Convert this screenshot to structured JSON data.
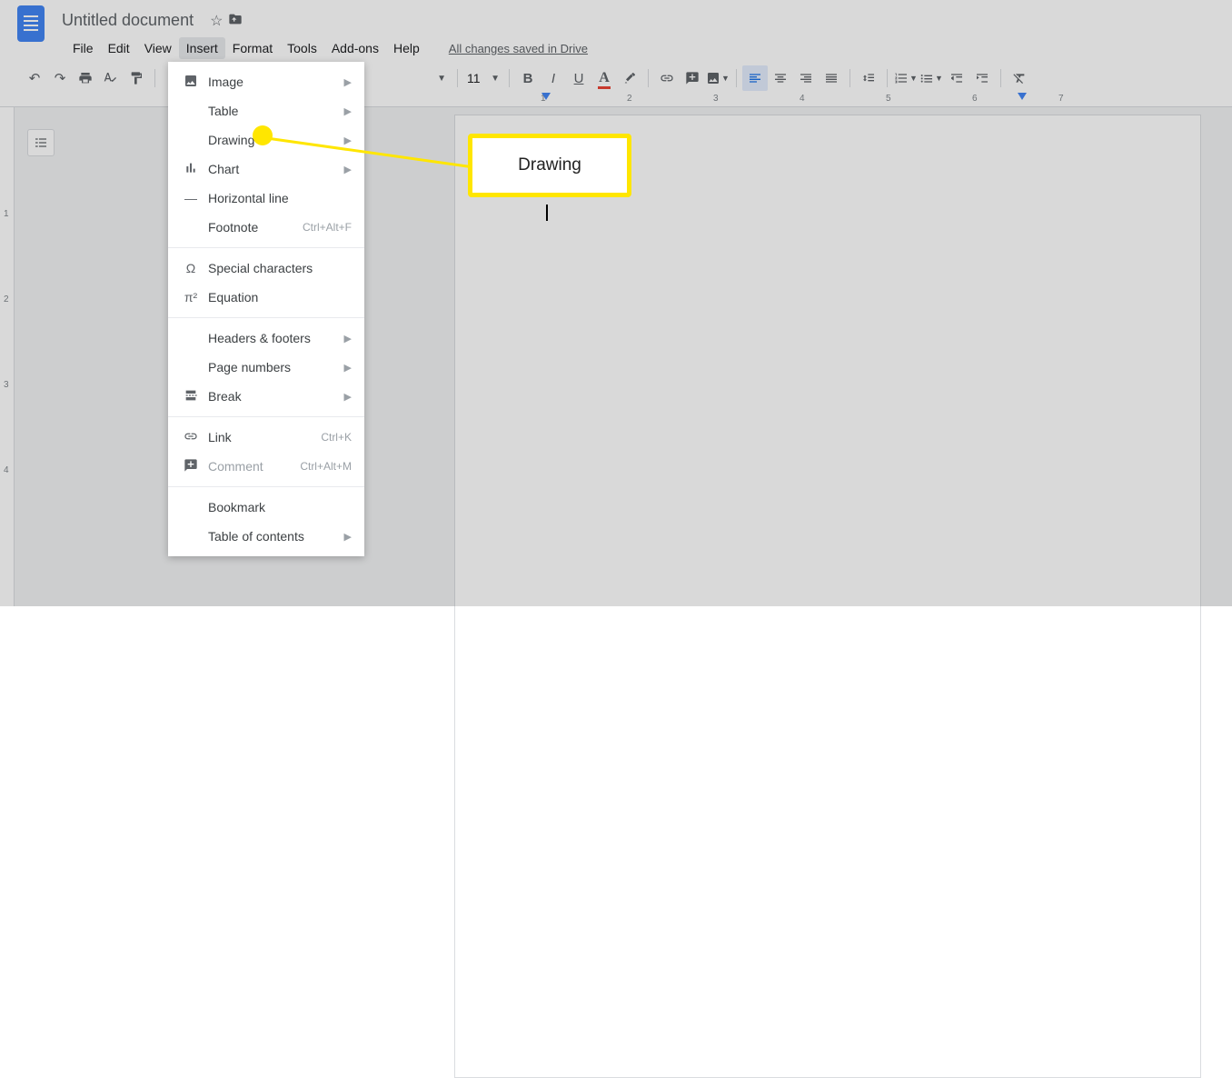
{
  "header": {
    "doc_title": "Untitled document"
  },
  "menubar": {
    "file": "File",
    "edit": "Edit",
    "view": "View",
    "insert": "Insert",
    "format": "Format",
    "tools": "Tools",
    "addons": "Add-ons",
    "help": "Help",
    "save_status": "All changes saved in Drive"
  },
  "toolbar": {
    "font_size": "11"
  },
  "insert_menu": {
    "image": "Image",
    "table": "Table",
    "drawing": "Drawing",
    "chart": "Chart",
    "horizontal_line": "Horizontal line",
    "footnote": "Footnote",
    "footnote_sc": "Ctrl+Alt+F",
    "special_chars": "Special characters",
    "equation": "Equation",
    "headers_footers": "Headers & footers",
    "page_numbers": "Page numbers",
    "break": "Break",
    "link": "Link",
    "link_sc": "Ctrl+K",
    "comment": "Comment",
    "comment_sc": "Ctrl+Alt+M",
    "bookmark": "Bookmark",
    "toc": "Table of contents"
  },
  "ruler": {
    "h": [
      "1",
      "2",
      "3",
      "4",
      "5",
      "6",
      "7"
    ],
    "v": [
      "1",
      "2",
      "3",
      "4"
    ]
  },
  "annotation": {
    "callout": "Drawing"
  }
}
